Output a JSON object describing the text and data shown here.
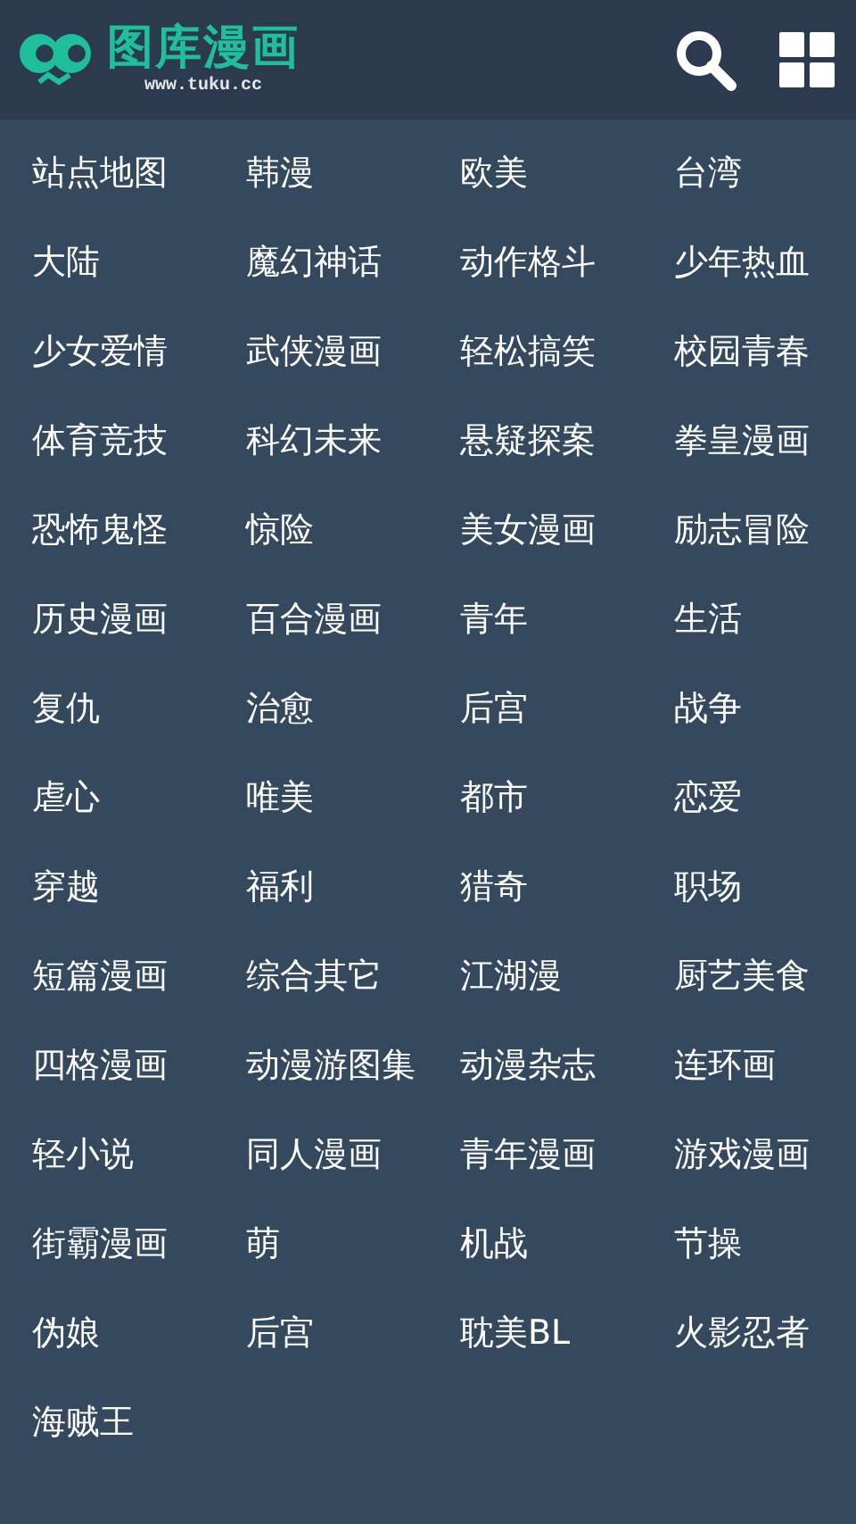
{
  "header": {
    "logo_title": "图库漫画",
    "logo_url": "www.tuku.cc"
  },
  "categories": [
    "站点地图",
    "韩漫",
    "欧美",
    "台湾",
    "大陆",
    "魔幻神话",
    "动作格斗",
    "少年热血",
    "少女爱情",
    "武侠漫画",
    "轻松搞笑",
    "校园青春",
    "体育竞技",
    "科幻未来",
    "悬疑探案",
    "拳皇漫画",
    "恐怖鬼怪",
    "惊险",
    "美女漫画",
    "励志冒险",
    "历史漫画",
    "百合漫画",
    "青年",
    "生活",
    "复仇",
    "治愈",
    "后宫",
    "战争",
    "虐心",
    "唯美",
    "都市",
    "恋爱",
    "穿越",
    "福利",
    "猎奇",
    "职场",
    "短篇漫画",
    "综合其它",
    "江湖漫",
    "厨艺美食",
    "四格漫画",
    "动漫游图集",
    "动漫杂志",
    "连环画",
    "轻小说",
    "同人漫画",
    "青年漫画",
    "游戏漫画",
    "街霸漫画",
    "萌",
    "机战",
    "节操",
    "伪娘",
    "后宫",
    "耽美BL",
    "火影忍者",
    "海贼王"
  ]
}
